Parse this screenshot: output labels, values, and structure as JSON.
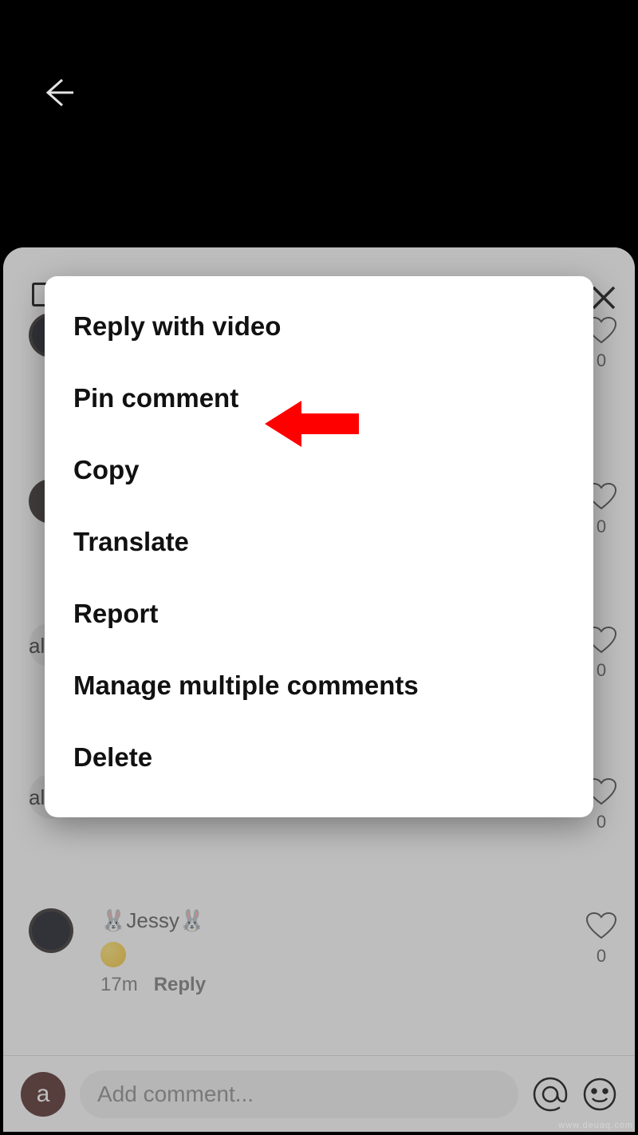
{
  "menu": {
    "items": [
      {
        "label": "Reply with video"
      },
      {
        "label": "Pin comment"
      },
      {
        "label": "Copy"
      },
      {
        "label": "Translate"
      },
      {
        "label": "Report"
      },
      {
        "label": "Manage multiple comments"
      },
      {
        "label": "Delete"
      }
    ]
  },
  "comments": {
    "visible": {
      "name_prefix": "🐰",
      "name": "Jessy",
      "name_suffix": "🐰",
      "time": "17m",
      "reply_label": "Reply",
      "like_count": "0"
    },
    "bg_like_count": "0",
    "bg_name_fragment": "al"
  },
  "composer": {
    "avatar_letter": "a",
    "placeholder": "Add comment..."
  },
  "watermark": "www.deuaq.com"
}
